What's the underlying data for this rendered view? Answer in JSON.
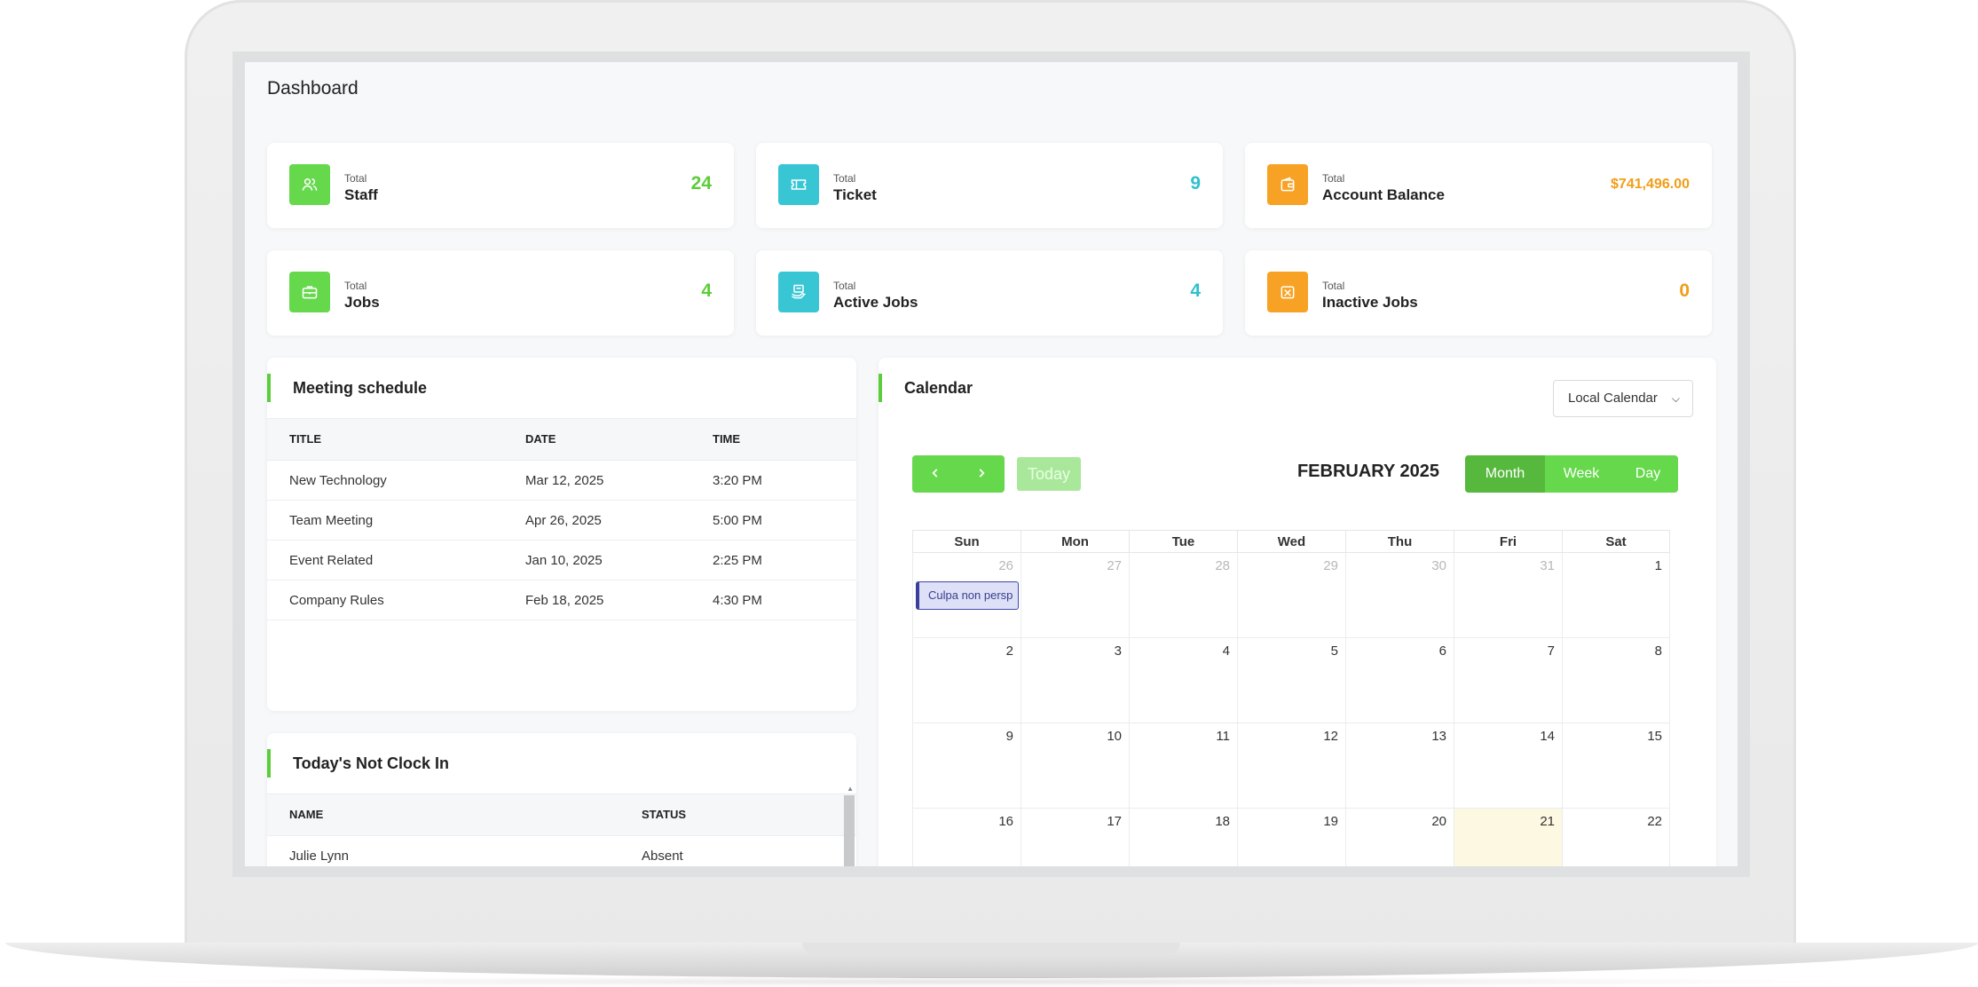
{
  "page": {
    "title": "Dashboard"
  },
  "stats": [
    {
      "small": "Total",
      "label": "Staff",
      "value": "24",
      "icon": "users-icon",
      "color": "#66d84c"
    },
    {
      "small": "Total",
      "label": "Ticket",
      "value": "9",
      "icon": "ticket-icon",
      "color": "#38c6d4"
    },
    {
      "small": "Total",
      "label": "Account Balance",
      "value": "$741,496.00",
      "icon": "wallet-icon",
      "color": "#f7a224"
    },
    {
      "small": "Total",
      "label": "Jobs",
      "value": "4",
      "icon": "briefcase-icon",
      "color": "#66d84c"
    },
    {
      "small": "Total",
      "label": "Active Jobs",
      "value": "4",
      "icon": "active-jobs-icon",
      "color": "#38c6d4"
    },
    {
      "small": "Total",
      "label": "Inactive Jobs",
      "value": "0",
      "icon": "inactive-jobs-icon",
      "color": "#f7a224"
    }
  ],
  "meeting": {
    "title": "Meeting schedule",
    "columns": [
      "TITLE",
      "DATE",
      "TIME"
    ],
    "rows": [
      {
        "title": "New Technology",
        "date": "Mar 12, 2025",
        "time": "3:20 PM"
      },
      {
        "title": "Team Meeting",
        "date": "Apr 26, 2025",
        "time": "5:00 PM"
      },
      {
        "title": "Event Related",
        "date": "Jan 10, 2025",
        "time": "2:25 PM"
      },
      {
        "title": "Company Rules",
        "date": "Feb 18, 2025",
        "time": "4:30 PM"
      }
    ]
  },
  "clockin": {
    "title": "Today's Not Clock In",
    "columns": [
      "NAME",
      "STATUS"
    ],
    "rows": [
      {
        "name": "Julie Lynn",
        "status": "Absent"
      }
    ]
  },
  "calendar": {
    "title": "Calendar",
    "source_select": "Local Calendar",
    "month_label": "FEBRUARY 2025",
    "today_label": "Today",
    "views": [
      "Month",
      "Week",
      "Day"
    ],
    "active_view": "Month",
    "weekdays": [
      "Sun",
      "Mon",
      "Tue",
      "Wed",
      "Thu",
      "Fri",
      "Sat"
    ],
    "weeks": [
      [
        "26",
        "27",
        "28",
        "29",
        "30",
        "31",
        "1"
      ],
      [
        "2",
        "3",
        "4",
        "5",
        "6",
        "7",
        "8"
      ],
      [
        "9",
        "10",
        "11",
        "12",
        "13",
        "14",
        "15"
      ],
      [
        "16",
        "17",
        "18",
        "19",
        "20",
        "21",
        "22"
      ]
    ],
    "today": "21",
    "event": {
      "label": "Culpa non persp",
      "day": "26"
    },
    "accent": "#66d84c"
  }
}
